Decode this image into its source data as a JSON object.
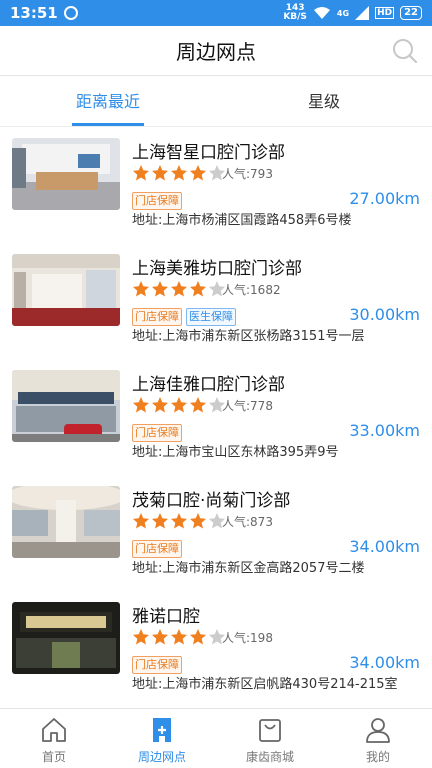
{
  "status_bar": {
    "time": "13:51",
    "net_speed_value": "143",
    "net_speed_unit": "KB/S",
    "network": "4G",
    "hd": "HD",
    "battery": "22"
  },
  "header": {
    "title": "周边网点"
  },
  "tabs": [
    {
      "label": "距离最近",
      "active": true
    },
    {
      "label": "星级",
      "active": false
    }
  ],
  "popularity_label": "人气:",
  "address_label": "地址:",
  "stores": [
    {
      "name": "上海智星口腔门诊部",
      "rating": 4,
      "popularity": "793",
      "tags": [
        "门店保障"
      ],
      "distance": "27.00km",
      "address": "上海市杨浦区国霞路458弄6号楼"
    },
    {
      "name": "上海美雅坊口腔门诊部",
      "rating": 4,
      "popularity": "1682",
      "tags": [
        "门店保障",
        "医生保障"
      ],
      "distance": "30.00km",
      "address": "上海市浦东新区张杨路3151号一层"
    },
    {
      "name": "上海佳雅口腔门诊部",
      "rating": 4,
      "popularity": "778",
      "tags": [
        "门店保障"
      ],
      "distance": "33.00km",
      "address": "上海市宝山区东林路395弄9号"
    },
    {
      "name": "茂菊口腔·尚菊门诊部",
      "rating": 4,
      "popularity": "873",
      "tags": [
        "门店保障"
      ],
      "distance": "34.00km",
      "address": "上海市浦东新区金高路2057号二楼"
    },
    {
      "name": "雅诺口腔",
      "rating": 4,
      "popularity": "198",
      "tags": [
        "门店保障"
      ],
      "distance": "34.00km",
      "address": "上海市浦东新区启帆路430号214-215室"
    }
  ],
  "bottom_nav": [
    {
      "label": "首页",
      "icon": "home-icon",
      "active": false
    },
    {
      "label": "周边网点",
      "icon": "nearby-icon",
      "active": true
    },
    {
      "label": "康齿商城",
      "icon": "shop-icon",
      "active": false
    },
    {
      "label": "我的",
      "icon": "profile-icon",
      "active": false
    }
  ],
  "colors": {
    "accent": "#2f8ee8",
    "star": "#f07f1f",
    "star_empty": "#cccccc",
    "tag_store": "#e87a1f",
    "tag_doctor": "#2f8ee8"
  }
}
